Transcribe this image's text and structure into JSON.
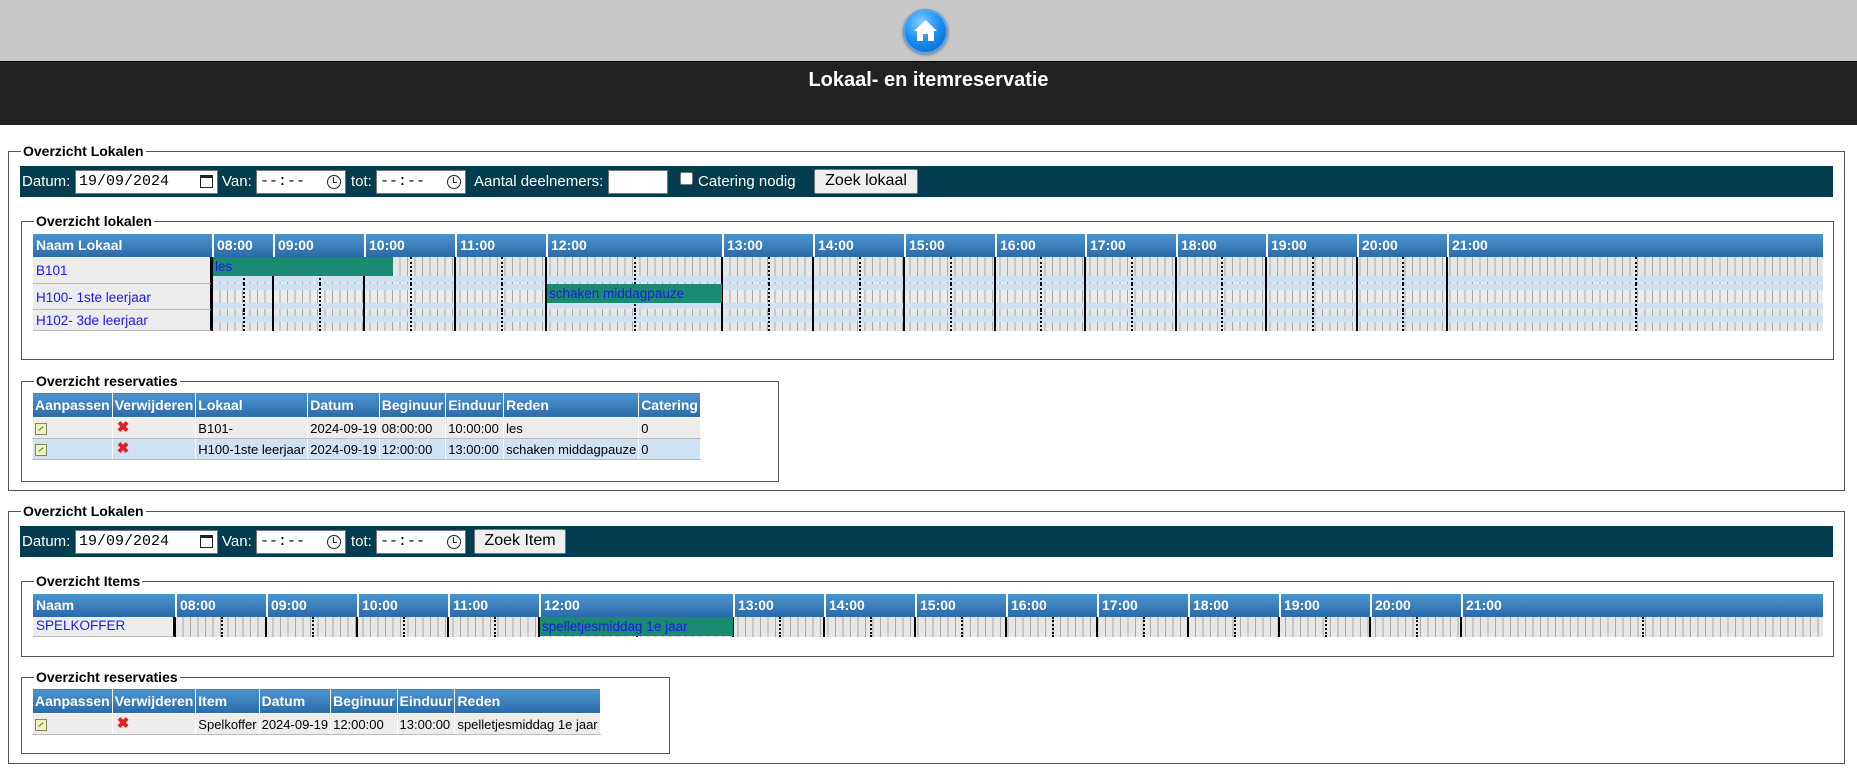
{
  "header": {
    "home_label": "home-icon",
    "title": "Lokaal- en itemreservatie"
  },
  "rooms": {
    "section_legend": "Overzicht Lokalen",
    "search": {
      "date_label": "Datum:",
      "date_value": "19/09/2024",
      "from_label": "Van:",
      "from_value": "--:--",
      "to_label": "tot:",
      "to_value": "--:--",
      "participants_label": "Aantal deelnemers:",
      "participants_value": "",
      "catering_label": "Catering nodig",
      "catering_checked": false,
      "search_button": "Zoek lokaal"
    },
    "overview": {
      "legend": "Overzicht lokalen",
      "name_header": "Naam Lokaal",
      "hours": [
        "08:00",
        "09:00",
        "10:00",
        "11:00",
        "12:00",
        "13:00",
        "14:00",
        "15:00",
        "16:00",
        "17:00",
        "18:00",
        "19:00",
        "20:00",
        "21:00"
      ],
      "rows": [
        {
          "name": "B101",
          "reservation": "les"
        },
        {
          "name": "H100- 1ste leerjaar",
          "reservation": "schaken middagpauze"
        },
        {
          "name": "H102- 3de leerjaar",
          "reservation": ""
        }
      ]
    },
    "reservations": {
      "legend": "Overzicht reservaties",
      "headers": [
        "Aanpassen",
        "Verwijderen",
        "Lokaal",
        "Datum",
        "Beginuur",
        "Einduur",
        "Reden",
        "Catering"
      ],
      "rows": [
        {
          "lokaal": "B101-",
          "datum": "2024-09-19",
          "begin": "08:00:00",
          "eind": "10:00:00",
          "reden": "les",
          "catering": "0"
        },
        {
          "lokaal": "H100-1ste leerjaar",
          "datum": "2024-09-19",
          "begin": "12:00:00",
          "eind": "13:00:00",
          "reden": "schaken middagpauze",
          "catering": "0"
        }
      ]
    }
  },
  "items": {
    "section_legend": "Overzicht Lokalen",
    "search": {
      "date_label": "Datum:",
      "date_value": "19/09/2024",
      "from_label": "Van:",
      "from_value": "--:--",
      "to_label": "tot:",
      "to_value": "--:--",
      "search_button": "Zoek Item"
    },
    "overview": {
      "legend": "Overzicht Items",
      "name_header": "Naam",
      "hours": [
        "08:00",
        "09:00",
        "10:00",
        "11:00",
        "12:00",
        "13:00",
        "14:00",
        "15:00",
        "16:00",
        "17:00",
        "18:00",
        "19:00",
        "20:00",
        "21:00"
      ],
      "rows": [
        {
          "name": "SPELKOFFER",
          "reservation": "spelletjesmiddag 1e jaar"
        }
      ]
    },
    "reservations": {
      "legend": "Overzicht reservaties",
      "headers": [
        "Aanpassen",
        "Verwijderen",
        "Item",
        "Datum",
        "Beginuur",
        "Einduur",
        "Reden"
      ],
      "rows": [
        {
          "item": "Spelkoffer",
          "datum": "2024-09-19",
          "begin": "12:00:00",
          "eind": "13:00:00",
          "reden": "spelletjesmiddag 1e jaar"
        }
      ]
    }
  },
  "colors": {
    "topbar": "#c9c8c9",
    "titlebar": "#222222",
    "searchbar": "#023c4f",
    "reservation_block": "#1b8a73",
    "link": "#1a1aeb"
  }
}
